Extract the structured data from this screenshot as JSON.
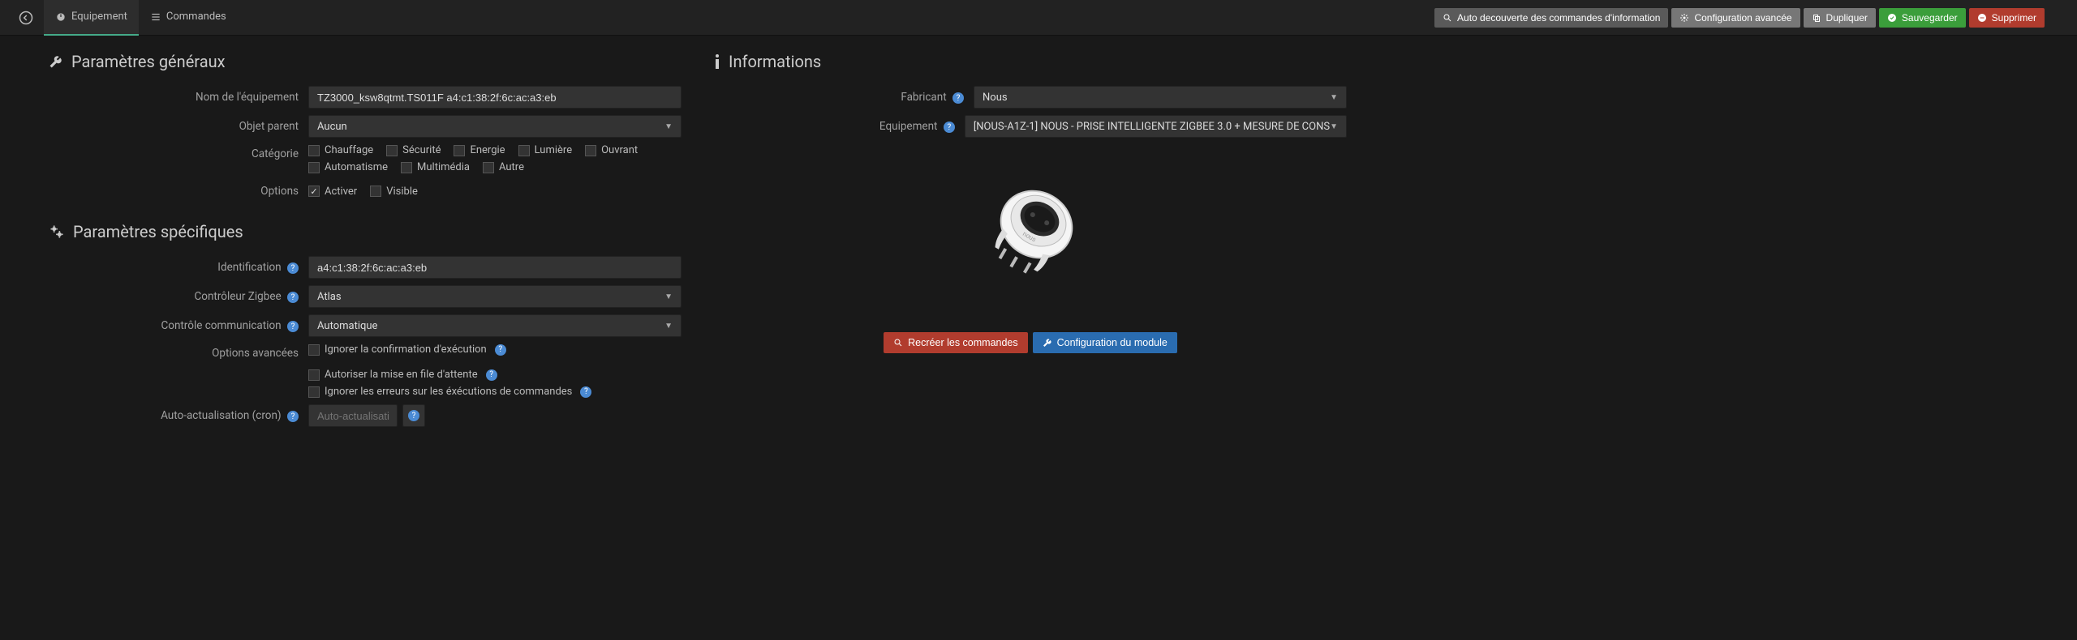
{
  "topbar": {
    "tabs": {
      "equipment": "Equipement",
      "commands": "Commandes"
    },
    "buttons": {
      "auto_discover": "Auto decouverte des commandes d'information",
      "advanced_config": "Configuration avancée",
      "duplicate": "Dupliquer",
      "save": "Sauvegarder",
      "delete": "Supprimer"
    }
  },
  "general": {
    "title": "Paramètres généraux",
    "labels": {
      "name": "Nom de l'équipement",
      "parent": "Objet parent",
      "category": "Catégorie",
      "options": "Options"
    },
    "values": {
      "name": "TZ3000_ksw8qtmt.TS011F a4:c1:38:2f:6c:ac:a3:eb",
      "parent": "Aucun"
    },
    "categories": {
      "heating": "Chauffage",
      "security": "Sécurité",
      "energy": "Energie",
      "light": "Lumière",
      "opening": "Ouvrant",
      "automation": "Automatisme",
      "multimedia": "Multimédia",
      "other": "Autre"
    },
    "options": {
      "activate": "Activer",
      "visible": "Visible"
    }
  },
  "specific": {
    "title": "Paramètres spécifiques",
    "labels": {
      "identification": "Identification",
      "zigbee_controller": "Contrôleur Zigbee",
      "comm_control": "Contrôle communication",
      "advanced_options": "Options avancées",
      "auto_refresh": "Auto-actualisation (cron)"
    },
    "values": {
      "identification": "a4:c1:38:2f:6c:ac:a3:eb",
      "zigbee_controller": "Atlas",
      "comm_control": "Automatique",
      "auto_refresh_placeholder": "Auto-actualisatio"
    },
    "advanced": {
      "ignore_exec_confirm": "Ignorer la confirmation d'exécution",
      "allow_queue": "Autoriser la mise en file d'attente",
      "ignore_cmd_errors": "Ignorer les erreurs sur les éxécutions de commandes"
    }
  },
  "info": {
    "title": "Informations",
    "labels": {
      "manufacturer": "Fabricant",
      "equipment": "Equipement"
    },
    "values": {
      "manufacturer": "Nous",
      "equipment": "[NOUS-A1Z-1] NOUS - PRISE INTELLIGENTE ZIGBEE 3.0 + MESURE DE CONS"
    },
    "buttons": {
      "recreate": "Recréer les commandes",
      "module_config": "Configuration du module"
    }
  }
}
